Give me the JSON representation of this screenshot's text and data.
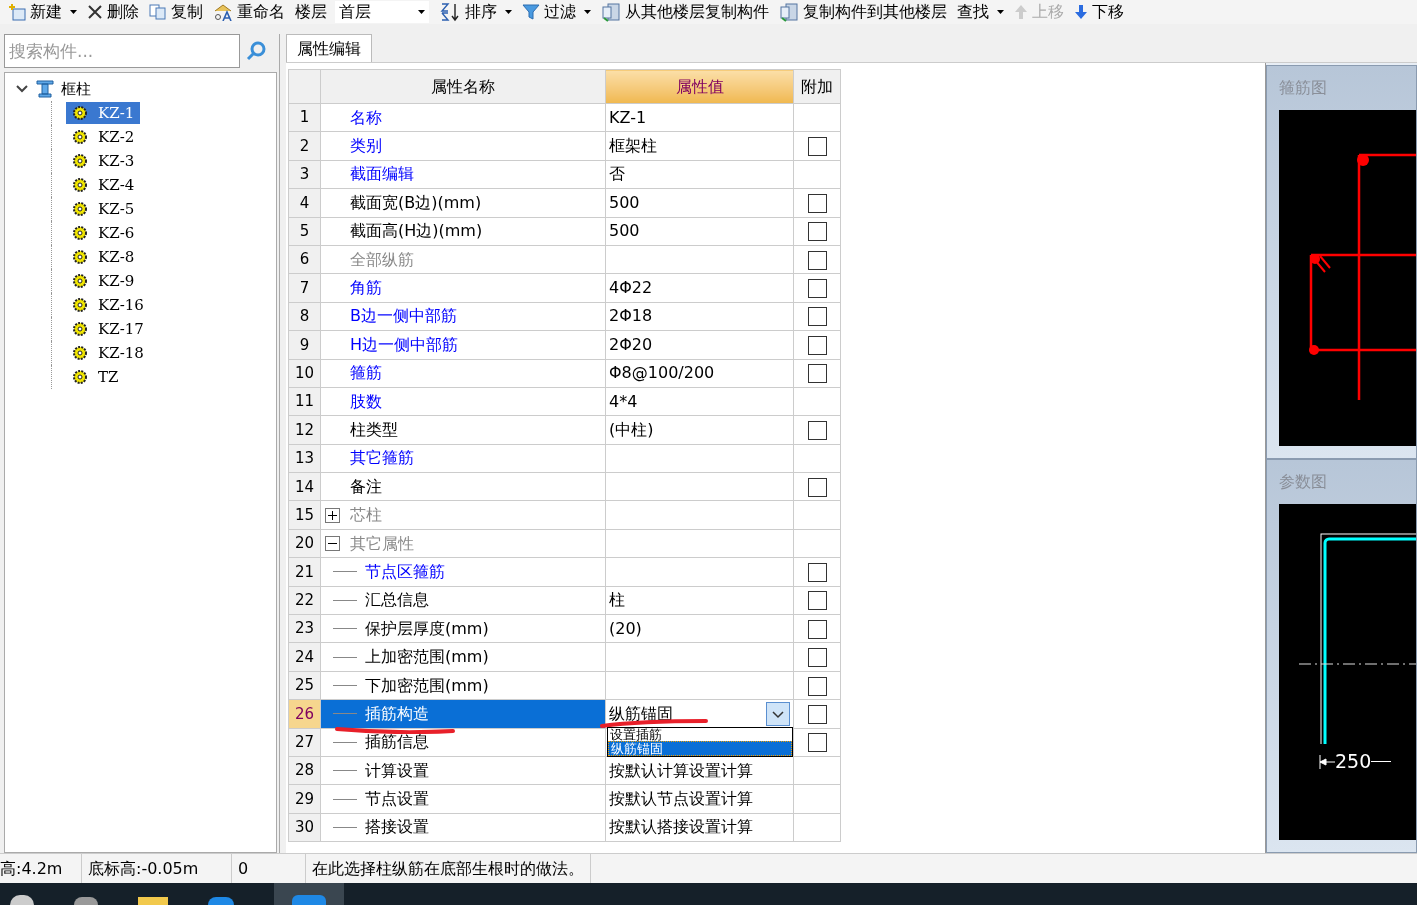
{
  "toolbar": [
    {
      "kind": "new",
      "label": "新建",
      "dropdown": true,
      "disabled": false
    },
    {
      "kind": "delete",
      "label": "删除",
      "dropdown": false,
      "disabled": false
    },
    {
      "kind": "copy",
      "label": "复制",
      "dropdown": false,
      "disabled": false
    },
    {
      "kind": "rename",
      "label": "重命名",
      "dropdown": false,
      "disabled": false
    },
    {
      "kind": "floor",
      "label": "楼层",
      "value": "首层"
    },
    {
      "kind": "sort",
      "label": "排序",
      "dropdown": true,
      "disabled": false
    },
    {
      "kind": "filter",
      "label": "过滤",
      "dropdown": true,
      "disabled": false
    },
    {
      "kind": "copy-from",
      "label": "从其他楼层复制构件",
      "dropdown": false,
      "disabled": false
    },
    {
      "kind": "copy-to",
      "label": "复制构件到其他楼层",
      "dropdown": false,
      "disabled": false
    },
    {
      "kind": "find",
      "label": "查找",
      "dropdown": true,
      "disabled": false
    },
    {
      "kind": "up",
      "label": "上移",
      "dropdown": false,
      "disabled": true
    },
    {
      "kind": "down",
      "label": "下移",
      "dropdown": false,
      "disabled": false
    }
  ],
  "search": {
    "placeholder": "搜索构件..."
  },
  "tree": {
    "label": "框柱",
    "expanded": true,
    "children": [
      {
        "label": "KZ-1",
        "selected": true
      },
      {
        "label": "KZ-2",
        "selected": false
      },
      {
        "label": "KZ-3",
        "selected": false
      },
      {
        "label": "KZ-4",
        "selected": false
      },
      {
        "label": "KZ-5",
        "selected": false
      },
      {
        "label": "KZ-6",
        "selected": false
      },
      {
        "label": "KZ-8",
        "selected": false
      },
      {
        "label": "KZ-9",
        "selected": false
      },
      {
        "label": "KZ-16",
        "selected": false
      },
      {
        "label": "KZ-17",
        "selected": false
      },
      {
        "label": "KZ-18",
        "selected": false
      },
      {
        "label": "TZ",
        "selected": false
      }
    ]
  },
  "tab": {
    "label": "属性编辑",
    "selected": true
  },
  "table": {
    "columns": [
      "属性名称",
      "属性值",
      "附加"
    ],
    "rows": [
      {
        "no": "1",
        "name": "名称",
        "value": "KZ-1",
        "kind": "link",
        "selected": false
      },
      {
        "no": "2",
        "name": "类别",
        "value": "框架柱",
        "kind": "link",
        "checked": false,
        "selected": false
      },
      {
        "no": "3",
        "name": "截面编辑",
        "value": "否",
        "kind": "link",
        "selected": false
      },
      {
        "no": "4",
        "name": "截面宽(B边)(mm)",
        "value": "500",
        "kind": "plain",
        "checked": false,
        "selected": false
      },
      {
        "no": "5",
        "name": "截面高(H边)(mm)",
        "value": "500",
        "kind": "plain",
        "checked": false,
        "selected": false
      },
      {
        "no": "6",
        "name": "全部纵筋",
        "value": "",
        "kind": "muted",
        "checked": false,
        "selected": false
      },
      {
        "no": "7",
        "name": "角筋",
        "value": "4Φ22",
        "kind": "link",
        "checked": false,
        "selected": false
      },
      {
        "no": "8",
        "name": "B边一侧中部筋",
        "value": "2Φ18",
        "kind": "link",
        "checked": false,
        "selected": false
      },
      {
        "no": "9",
        "name": "H边一侧中部筋",
        "value": "2Φ20",
        "kind": "link",
        "checked": false,
        "selected": false
      },
      {
        "no": "10",
        "name": "箍筋",
        "value": "Φ8@100/200",
        "kind": "link",
        "checked": false,
        "selected": false
      },
      {
        "no": "11",
        "name": "肢数",
        "value": "4*4",
        "kind": "link",
        "selected": false
      },
      {
        "no": "12",
        "name": "柱类型",
        "value": "(中柱)",
        "kind": "plain",
        "checked": false,
        "selected": false
      },
      {
        "no": "13",
        "name": "其它箍筋",
        "value": "",
        "kind": "link",
        "selected": false
      },
      {
        "no": "14",
        "name": "备注",
        "value": "",
        "kind": "plain",
        "checked": false,
        "selected": false
      },
      {
        "no": "15",
        "name": "芯柱",
        "value": "",
        "kind": "muted",
        "expanded": false,
        "selected": false
      },
      {
        "no": "20",
        "name": "其它属性",
        "value": "",
        "kind": "muted",
        "expanded": true,
        "selected": false
      },
      {
        "no": "21",
        "name": "节点区箍筋",
        "value": "",
        "kind": "link",
        "child": true,
        "checked": false,
        "selected": false
      },
      {
        "no": "22",
        "name": "汇总信息",
        "value": "柱",
        "kind": "plain",
        "child": true,
        "checked": false,
        "selected": false
      },
      {
        "no": "23",
        "name": "保护层厚度(mm)",
        "value": "(20)",
        "kind": "plain",
        "child": true,
        "checked": false,
        "selected": false
      },
      {
        "no": "24",
        "name": "上加密范围(mm)",
        "value": "",
        "kind": "plain",
        "child": true,
        "checked": false,
        "selected": false
      },
      {
        "no": "25",
        "name": "下加密范围(mm)",
        "value": "",
        "kind": "plain",
        "child": true,
        "checked": false,
        "selected": false
      },
      {
        "no": "26",
        "name": "插筋构造",
        "value": "纵筋锚固",
        "kind": "plain",
        "child": true,
        "checked": false,
        "selected": true,
        "options": [
          {
            "label": "设置插筋",
            "selected": false
          },
          {
            "label": "纵筋锚固",
            "selected": true
          }
        ]
      },
      {
        "no": "27",
        "name": "插筋信息",
        "value": "",
        "kind": "plain",
        "child": true,
        "checked": false,
        "selected": false
      },
      {
        "no": "28",
        "name": "计算设置",
        "value": "按默认计算设置计算",
        "kind": "plain",
        "child": true,
        "selected": false
      },
      {
        "no": "29",
        "name": "节点设置",
        "value": "按默认节点设置计算",
        "kind": "plain",
        "child": true,
        "selected": false
      },
      {
        "no": "30",
        "name": "搭接设置",
        "value": "按默认搭接设置计算",
        "kind": "plain",
        "child": true,
        "selected": false
      }
    ]
  },
  "previews": [
    {
      "kind": "stirrup",
      "title": "箍筋图"
    },
    {
      "kind": "param",
      "title": "参数图",
      "dimension": "250"
    }
  ],
  "status_bar": [
    "高:4.2m",
    "底标高:-0.05m",
    "0",
    "在此选择柱纵筋在底部生根时的做法。"
  ]
}
